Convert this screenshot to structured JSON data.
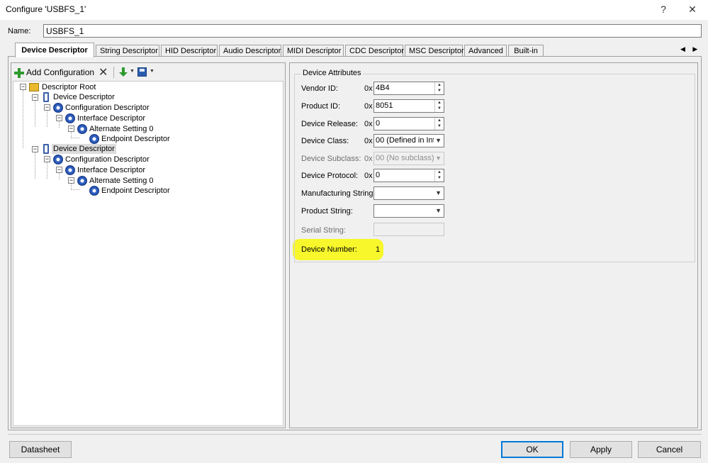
{
  "window": {
    "title": "Configure 'USBFS_1'",
    "help_glyph": "?",
    "close_glyph": "✕"
  },
  "name": {
    "label": "Name:",
    "value": "USBFS_1"
  },
  "tabs": [
    "Device Descriptor",
    "String Descriptor",
    "HID Descriptor",
    "Audio Descriptor",
    "MIDI Descriptor",
    "CDC Descriptor",
    "MSC Descriptor",
    "Advanced",
    "Built-in"
  ],
  "tab_arrows": "◀ ▶",
  "toolbar": {
    "add_configuration": "Add Configuration"
  },
  "tree": [
    {
      "label": "Descriptor Root",
      "icon": "folder-icon"
    },
    {
      "label": "Device Descriptor",
      "icon": "device-icon"
    },
    {
      "label": "Configuration Descriptor",
      "icon": "gear-icon"
    },
    {
      "label": "Interface Descriptor",
      "icon": "gear-icon"
    },
    {
      "label": "Alternate Setting 0",
      "icon": "gear-icon"
    },
    {
      "label": "Endpoint Descriptor",
      "icon": "gear-icon"
    },
    {
      "label": "Device Descriptor",
      "icon": "device-icon",
      "selected": true
    },
    {
      "label": "Configuration Descriptor",
      "icon": "gear-icon"
    },
    {
      "label": "Interface Descriptor",
      "icon": "gear-icon"
    },
    {
      "label": "Alternate Setting 0",
      "icon": "gear-icon"
    },
    {
      "label": "Endpoint Descriptor",
      "icon": "gear-icon"
    }
  ],
  "attributes": {
    "group_title": "Device Attributes",
    "hex_prefix": "0x",
    "vendor_id": {
      "label": "Vendor ID:",
      "value": "4B4"
    },
    "product_id": {
      "label": "Product ID:",
      "value": "8051"
    },
    "device_release": {
      "label": "Device Release:",
      "value": "0"
    },
    "device_class": {
      "label": "Device Class:",
      "value": "00 (Defined in Inte"
    },
    "device_subclass": {
      "label": "Device Subclass:",
      "value": "00 (No subclass)"
    },
    "device_protocol": {
      "label": "Device Protocol:",
      "value": "0"
    },
    "manufacturing_string": {
      "label": "Manufacturing String:",
      "value": ""
    },
    "product_string": {
      "label": "Product String:",
      "value": ""
    },
    "serial_string": {
      "label": "Serial String:",
      "value": ""
    },
    "device_number": {
      "label": "Device Number:",
      "value": "1"
    }
  },
  "buttons": {
    "datasheet": "Datasheet",
    "ok": "OK",
    "apply": "Apply",
    "cancel": "Cancel"
  },
  "colors": {
    "highlight": "#f7f72c",
    "accent": "#0078d7"
  }
}
